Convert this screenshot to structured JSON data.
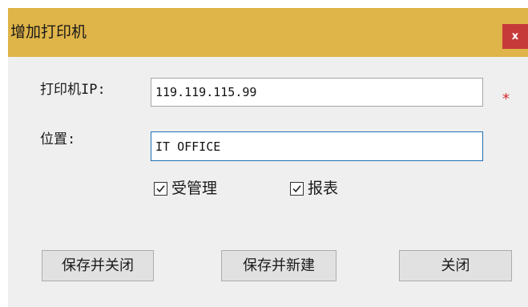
{
  "dialog": {
    "title": "增加打印机",
    "close_label": "x"
  },
  "form": {
    "ip": {
      "label": "打印机IP:",
      "value": "119.119.115.99",
      "required_mark": "*"
    },
    "location": {
      "label": "位置:",
      "value": "IT OFFICE"
    },
    "checkboxes": [
      {
        "label": "受管理",
        "checked": true
      },
      {
        "label": "报表",
        "checked": true
      }
    ]
  },
  "buttons": {
    "save_close": "保存并关闭",
    "save_new": "保存并新建",
    "close": "关闭"
  },
  "colors": {
    "titlebar": "#dfb448",
    "close_button": "#c63a3a",
    "dialog_background": "#efefef",
    "focused_border": "#1f6fb5",
    "required_mark": "#d8282a"
  }
}
